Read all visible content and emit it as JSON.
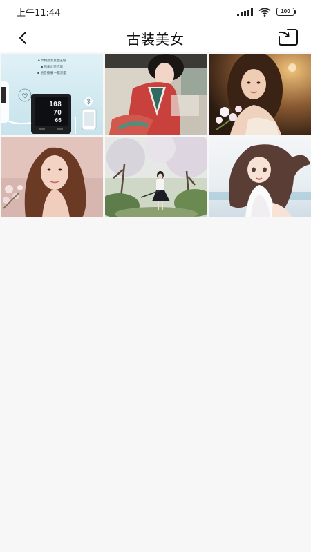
{
  "status_bar": {
    "time": "上午11:44",
    "battery": "100"
  },
  "header": {
    "title": "古装美女"
  },
  "gallery": {
    "images": [
      {
        "name": "blood-pressure-monitor-ad"
      },
      {
        "name": "hanfu-woman-red-robe"
      },
      {
        "name": "woman-with-flowers-warm-light"
      },
      {
        "name": "woman-portrait-pink-background"
      },
      {
        "name": "girl-with-umbrella-spring-trees"
      },
      {
        "name": "anime-girl-wind-hair"
      }
    ]
  },
  "ad_image": {
    "line1": "▪ 高精度测量血压值",
    "line2": "▪ 智能心率检测",
    "line3": "▪ 语音播报 一键测量",
    "sys": "108",
    "dia": "70",
    "pulse": "66"
  }
}
